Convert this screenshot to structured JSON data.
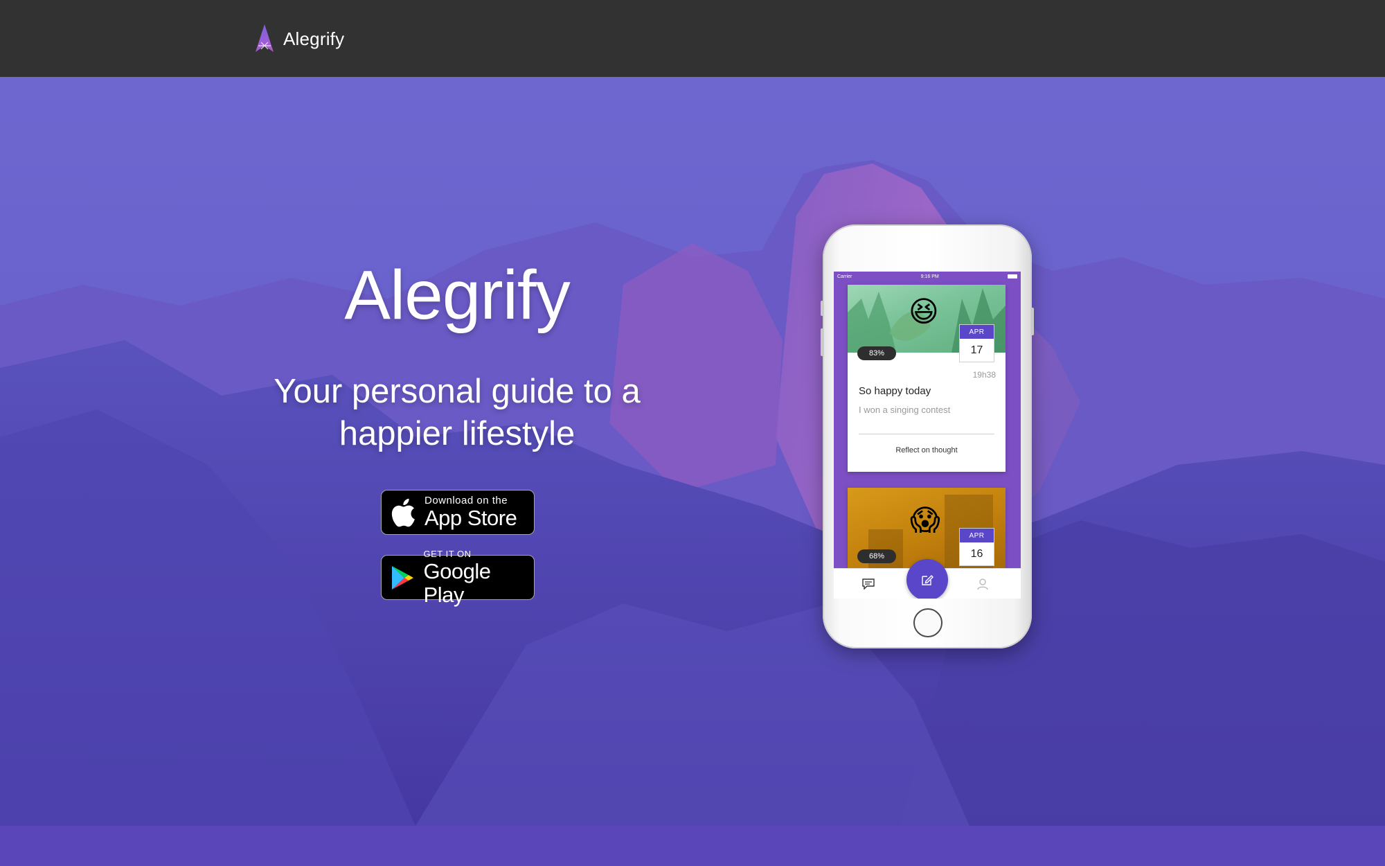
{
  "nav": {
    "brand_name": "Alegrify",
    "logo_icon": "alegrify-star-logo"
  },
  "hero": {
    "title": "Alegrify",
    "subtitle": "Your personal guide to a happier lifestyle",
    "background": "mountain-landscape-purple-tint"
  },
  "badges": {
    "apple": {
      "small": "Download on the",
      "large": "App Store",
      "icon": "apple-icon"
    },
    "google": {
      "small": "GET IT ON",
      "large": "Google Play",
      "icon": "google-play-icon"
    }
  },
  "phone": {
    "status": {
      "carrier": "Carrier",
      "time": "9:16 PM"
    },
    "cards": [
      {
        "emoji": "😆",
        "percent": "83%",
        "month": "APR",
        "day": "17",
        "time": "19h38",
        "title": "So happy today",
        "text": "I won a singing contest",
        "action": "Reflect on thought"
      },
      {
        "emoji": "😱",
        "percent": "68%",
        "month": "APR",
        "day": "16"
      }
    ],
    "tabbar": {
      "left_icon": "chat-icon",
      "center_icon": "edit-icon",
      "right_icon": "profile-icon"
    }
  },
  "colors": {
    "topbar": "#323232",
    "accent": "#5a46c8",
    "footer": "#5a46b8"
  }
}
